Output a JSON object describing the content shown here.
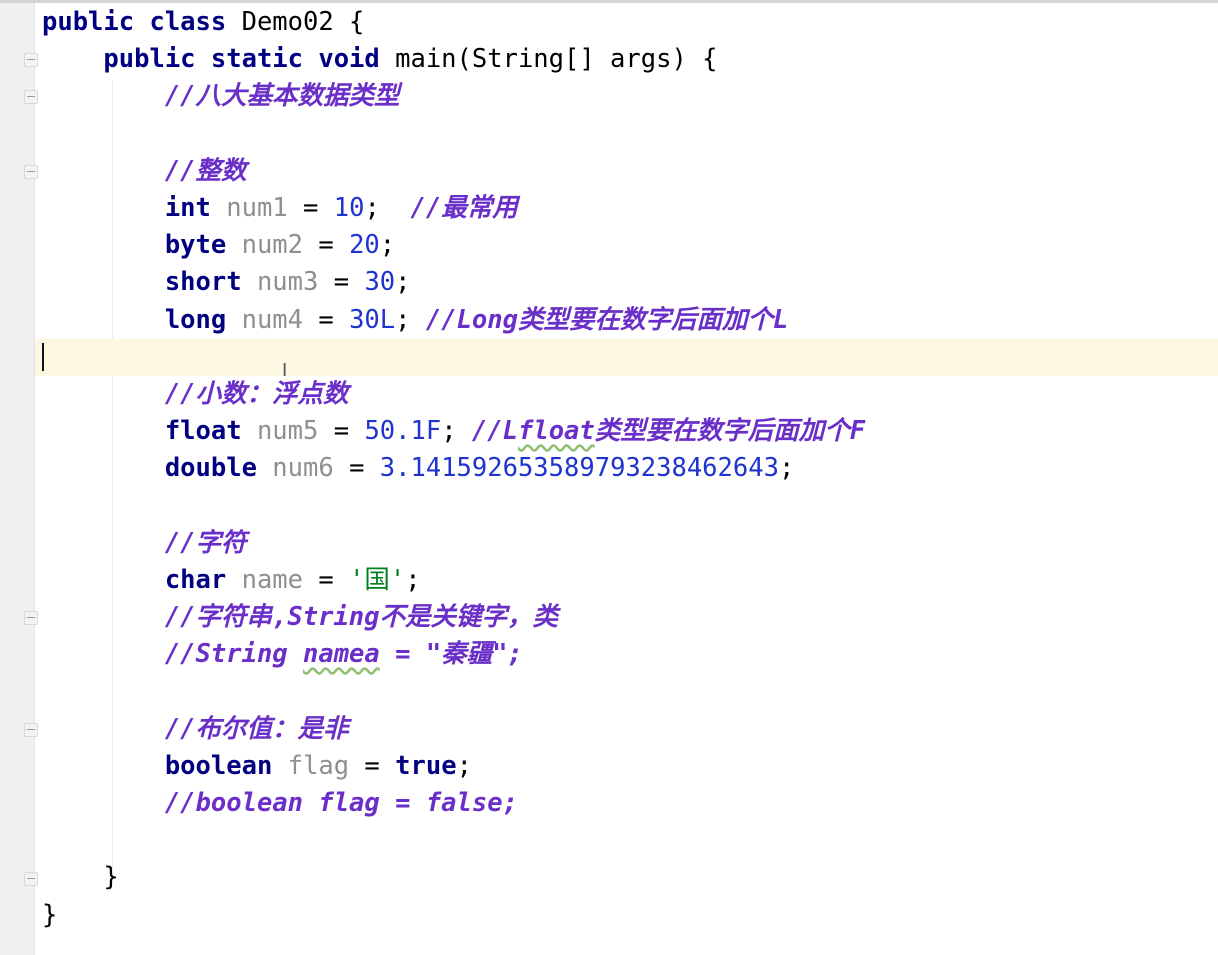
{
  "editor": {
    "lines": [
      [
        {
          "t": "kw",
          "v": "public class "
        },
        {
          "t": "plain",
          "v": "Demo02 {"
        }
      ],
      [
        {
          "t": "plain",
          "v": "    "
        },
        {
          "t": "kw",
          "v": "public static void "
        },
        {
          "t": "plain",
          "v": "main(String[] args) {"
        }
      ],
      [
        {
          "t": "plain",
          "v": "        "
        },
        {
          "t": "cmt",
          "v": "//八大基本数据类型"
        }
      ],
      [],
      [
        {
          "t": "plain",
          "v": "        "
        },
        {
          "t": "cmt",
          "v": "//整数"
        }
      ],
      [
        {
          "t": "plain",
          "v": "        "
        },
        {
          "t": "kw",
          "v": "int "
        },
        {
          "t": "var",
          "v": "num1"
        },
        {
          "t": "plain",
          "v": " = "
        },
        {
          "t": "num",
          "v": "10"
        },
        {
          "t": "plain",
          "v": ";  "
        },
        {
          "t": "cmt",
          "v": "//最常用"
        }
      ],
      [
        {
          "t": "plain",
          "v": "        "
        },
        {
          "t": "kw",
          "v": "byte "
        },
        {
          "t": "var",
          "v": "num2"
        },
        {
          "t": "plain",
          "v": " = "
        },
        {
          "t": "num",
          "v": "20"
        },
        {
          "t": "plain",
          "v": ";"
        }
      ],
      [
        {
          "t": "plain",
          "v": "        "
        },
        {
          "t": "kw",
          "v": "short "
        },
        {
          "t": "var",
          "v": "num3"
        },
        {
          "t": "plain",
          "v": " = "
        },
        {
          "t": "num",
          "v": "30"
        },
        {
          "t": "plain",
          "v": ";"
        }
      ],
      [
        {
          "t": "plain",
          "v": "        "
        },
        {
          "t": "kw",
          "v": "long "
        },
        {
          "t": "var",
          "v": "num4"
        },
        {
          "t": "plain",
          "v": " = "
        },
        {
          "t": "num",
          "v": "30L"
        },
        {
          "t": "plain",
          "v": "; "
        },
        {
          "t": "cmt",
          "v": "//Long类型要在数字后面加个L"
        }
      ],
      [],
      [
        {
          "t": "plain",
          "v": "        "
        },
        {
          "t": "cmt",
          "v": "//小数：浮点数"
        }
      ],
      [
        {
          "t": "plain",
          "v": "        "
        },
        {
          "t": "kw",
          "v": "float "
        },
        {
          "t": "var",
          "v": "num5"
        },
        {
          "t": "plain",
          "v": " = "
        },
        {
          "t": "num",
          "v": "50.1F"
        },
        {
          "t": "plain",
          "v": "; "
        },
        {
          "t": "cmt",
          "v": "//L"
        },
        {
          "t": "cmt squiggle",
          "v": "float"
        },
        {
          "t": "cmt",
          "v": "类型要在数字后面加个F"
        }
      ],
      [
        {
          "t": "plain",
          "v": "        "
        },
        {
          "t": "kw",
          "v": "double "
        },
        {
          "t": "var",
          "v": "num6"
        },
        {
          "t": "plain",
          "v": " = "
        },
        {
          "t": "num",
          "v": "3.141592653589793238462643"
        },
        {
          "t": "plain",
          "v": ";"
        }
      ],
      [],
      [
        {
          "t": "plain",
          "v": "        "
        },
        {
          "t": "cmt",
          "v": "//字符"
        }
      ],
      [
        {
          "t": "plain",
          "v": "        "
        },
        {
          "t": "kw",
          "v": "char "
        },
        {
          "t": "var",
          "v": "name"
        },
        {
          "t": "plain",
          "v": " = "
        },
        {
          "t": "str",
          "v": "'国'"
        },
        {
          "t": "plain",
          "v": ";"
        }
      ],
      [
        {
          "t": "plain",
          "v": "        "
        },
        {
          "t": "cmt",
          "v": "//字符串,String不是关键字，类"
        }
      ],
      [
        {
          "t": "plain",
          "v": "        "
        },
        {
          "t": "cmt",
          "v": "//String "
        },
        {
          "t": "cmt squiggle",
          "v": "namea"
        },
        {
          "t": "cmt",
          "v": " = \"秦疆\";"
        }
      ],
      [],
      [
        {
          "t": "plain",
          "v": "        "
        },
        {
          "t": "cmt",
          "v": "//布尔值：是非"
        }
      ],
      [
        {
          "t": "plain",
          "v": "        "
        },
        {
          "t": "kw",
          "v": "boolean "
        },
        {
          "t": "var",
          "v": "flag"
        },
        {
          "t": "plain",
          "v": " = "
        },
        {
          "t": "kw",
          "v": "true"
        },
        {
          "t": "plain",
          "v": ";"
        }
      ],
      [
        {
          "t": "plain",
          "v": "        "
        },
        {
          "t": "cmt",
          "v": "//boolean flag = false;"
        }
      ],
      [],
      [
        {
          "t": "plain",
          "v": "    }"
        }
      ],
      [
        {
          "t": "plain",
          "v": "}"
        }
      ]
    ],
    "caret_line_index": 9,
    "fold_marker_lines": [
      1,
      2,
      4,
      16,
      19,
      23
    ],
    "colors": {
      "keyword": "#000080",
      "variable": "#8f8f8f",
      "number": "#1f33d1",
      "comment": "#6a2fc8",
      "string": "#007f1f",
      "caret_line_bg": "#fdf8e1"
    }
  }
}
